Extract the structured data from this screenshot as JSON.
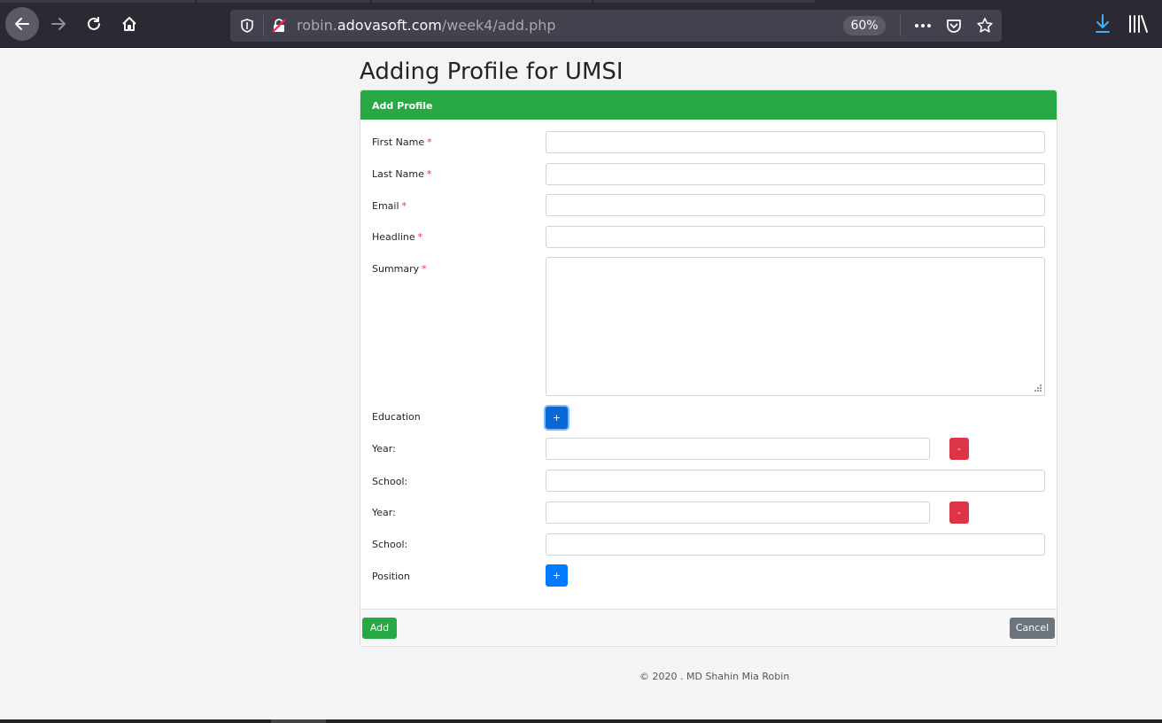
{
  "browser": {
    "url_prefix": "robin.",
    "url_host": "adovasoft.com",
    "url_path": "/week4/add.php",
    "zoom": "60%",
    "icons": [
      "back-icon",
      "forward-icon",
      "reload-icon",
      "home-icon",
      "shield-icon",
      "insecure-lock-icon",
      "more-icon",
      "pocket-icon",
      "star-icon",
      "download-icon",
      "library-icon"
    ]
  },
  "page": {
    "title": "Adding Profile for UMSI",
    "card_header": "Add Profile",
    "required_mark": "*"
  },
  "form": {
    "first_name_label": "First Name",
    "last_name_label": "Last Name",
    "email_label": "Email",
    "headline_label": "Headline",
    "summary_label": "Summary",
    "education_label": "Education",
    "position_label": "Position",
    "year_label": "Year:",
    "school_label": "School:",
    "plus_label": "+",
    "minus_label": "-",
    "first_name_value": "",
    "last_name_value": "",
    "email_value": "",
    "headline_value": "",
    "summary_value": "",
    "education_rows": [
      {
        "year": "",
        "school": ""
      },
      {
        "year": "",
        "school": ""
      }
    ]
  },
  "footer": {
    "add_label": "Add",
    "cancel_label": "Cancel",
    "copyright": "© 2020 . MD Shahin Mia Robin"
  },
  "colors": {
    "header_green": "#28a745",
    "primary_blue": "#007bff",
    "danger_red": "#dc3545",
    "secondary_gray": "#6c757d"
  }
}
